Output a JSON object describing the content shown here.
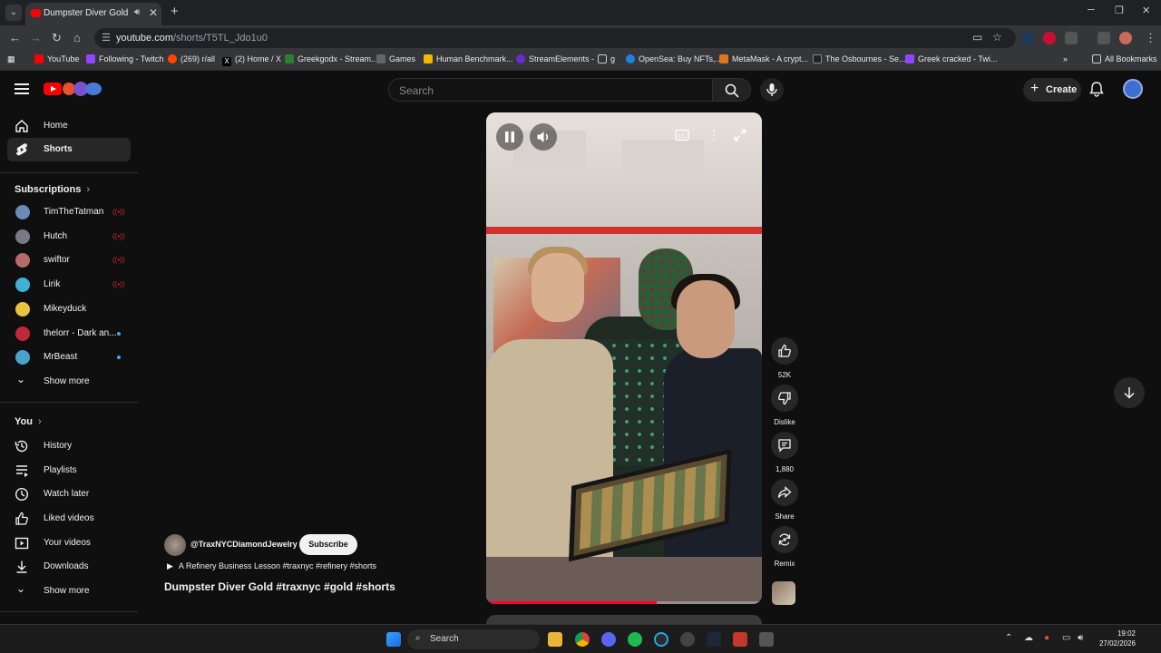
{
  "browser": {
    "tab_title": "Dumpster Diver Gold #traxn",
    "url_host": "youtube.com",
    "url_path": "/shorts/T5TL_Jdo1u0",
    "bookmarks": [
      "YouTube",
      "Following - Twitch",
      "(269) r/all",
      "(2) Home / X",
      "Greekgodx - Stream...",
      "Games",
      "Human Benchmark...",
      "StreamElements -",
      "g",
      "OpenSea: Buy NFTs,...",
      "MetaMask - A crypt...",
      "The Osbournes - Se...",
      "Greek cracked - Twi..."
    ],
    "all_bookmarks": "All Bookmarks"
  },
  "header": {
    "search_placeholder": "Search",
    "create_label": "Create"
  },
  "sidebar": {
    "home": "Home",
    "shorts": "Shorts",
    "subscriptions_title": "Subscriptions",
    "channels": [
      {
        "name": "TimTheTatman",
        "status": "live",
        "color": "#6b8ab5"
      },
      {
        "name": "Hutch",
        "status": "live",
        "color": "#7a7a86"
      },
      {
        "name": "swiftor",
        "status": "live",
        "color": "#b56b6b"
      },
      {
        "name": "Lirik",
        "status": "live",
        "color": "#3fb0d6"
      },
      {
        "name": "Mikeyduck",
        "status": "none",
        "color": "#e8c53a"
      },
      {
        "name": "thelorr - Dark an...",
        "status": "new",
        "color": "#c0283a"
      },
      {
        "name": "MrBeast",
        "status": "new",
        "color": "#4aa3c7"
      }
    ],
    "show_more": "Show more",
    "you_title": "You",
    "you_items": [
      "History",
      "Playlists",
      "Watch later",
      "Liked videos",
      "Your videos",
      "Downloads"
    ],
    "show_more_2": "Show more"
  },
  "video": {
    "progress": 0.62,
    "likes": "52K",
    "dislike": "Dislike",
    "comments": "1,880",
    "share": "Share",
    "remix": "Remix"
  },
  "meta": {
    "channel": "@TraxNYCDiamondJewelry",
    "subscribe": "Subscribe",
    "description": "A Refinery Business Lesson #traxnyc #refinery #shorts",
    "title": "Dumpster Diver Gold #traxnyc #gold #shorts"
  },
  "taskbar": {
    "search_label": "Search",
    "time": "19:02",
    "date": "27/02/2026"
  }
}
